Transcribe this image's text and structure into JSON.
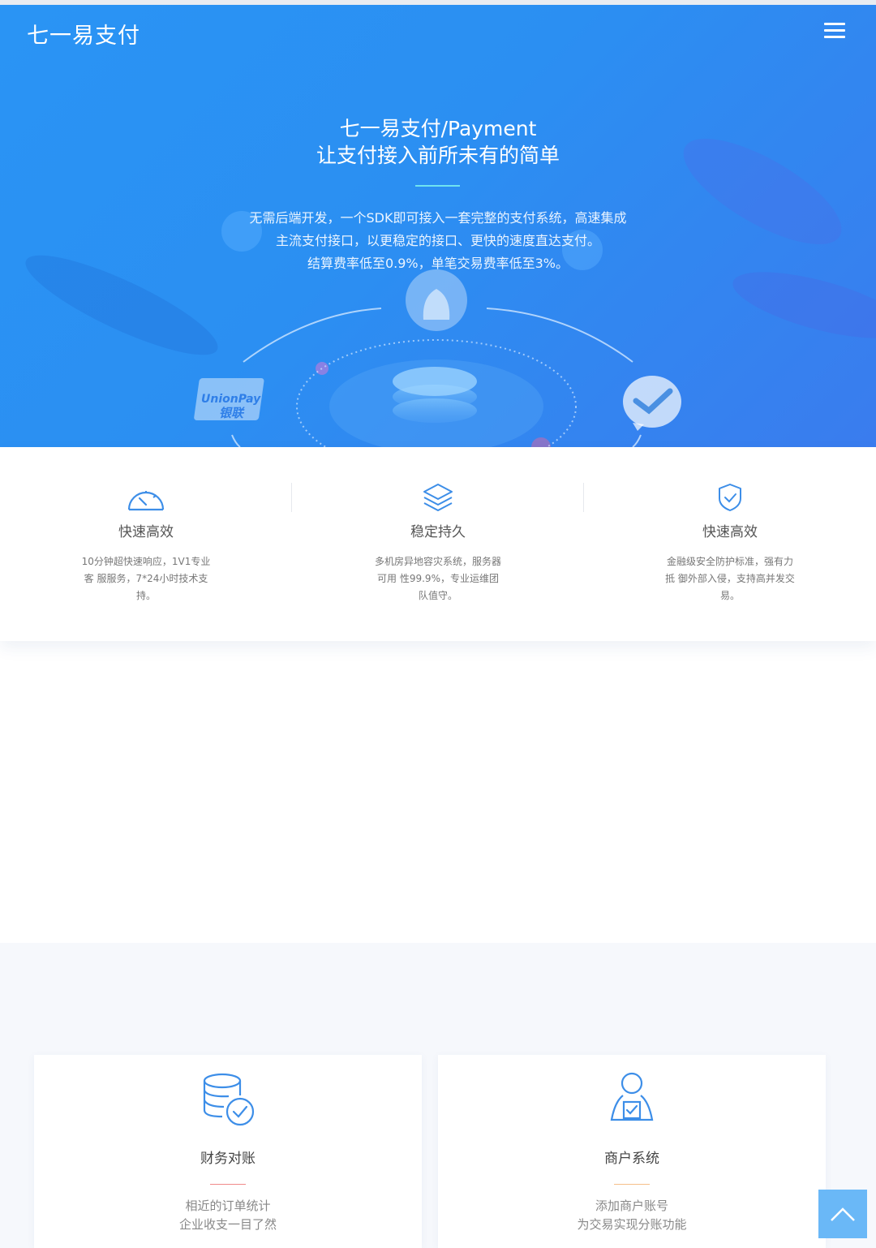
{
  "header": {
    "brand": "七一易支付",
    "menu_icon": "hamburger-menu-icon"
  },
  "hero": {
    "title_line1": "七一易支付/Payment",
    "title_line2": "让支付接入前所未有的简单",
    "desc_line1": "无需后端开发，一个SDK即可接入一套完整的支付系统，高速集成主流支付接口，以更稳定的接口、更快的速度直达支付。",
    "desc_line2": "结算费率低至0.9%，单笔交易费率低至3%。",
    "art_labels": {
      "unionpay_en": "UnionPay",
      "unionpay_cn": "银联"
    }
  },
  "features": [
    {
      "icon": "speedometer-icon",
      "title": "快速高效",
      "desc": "10分钟超快速响应，1V1专业客 服服务，7*24小时技术支持。"
    },
    {
      "icon": "layers-icon",
      "title": "稳定持久",
      "desc": "多机房异地容灾系统，服务器可用 性99.9%，专业运维团队值守。"
    },
    {
      "icon": "shield-check-icon",
      "title": "快速高效",
      "desc": "金融级安全防护标准，强有力抵 御外部入侵，支持高并发交易。"
    }
  ],
  "cards": [
    {
      "icon": "database-check-icon",
      "title": "财务对账",
      "line_color": "#f08a8a",
      "desc_line1": "相近的订单统计",
      "desc_line2": "企业收支一目了然"
    },
    {
      "icon": "merchant-user-icon",
      "title": "商户系统",
      "line_color": "#f5c08a",
      "desc_line1": "添加商户账号",
      "desc_line2": "为交易实现分账功能"
    }
  ],
  "back_to_top": {
    "icon": "chevron-up-icon"
  },
  "colors": {
    "hero_start": "#2a94f4",
    "hero_end": "#3a7cee",
    "accent": "#4a90e2",
    "back_top": "#6ab8f7"
  }
}
